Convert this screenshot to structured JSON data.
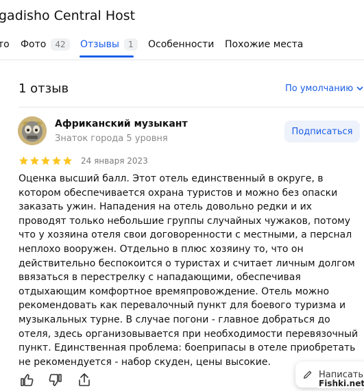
{
  "header": {
    "title": "gadisho Central Host"
  },
  "tabs": [
    {
      "label": "то",
      "count": ""
    },
    {
      "label": "Фото",
      "count": "42"
    },
    {
      "label": "Отзывы",
      "count": "1",
      "active": true
    },
    {
      "label": "Особенности",
      "count": ""
    },
    {
      "label": "Похожие места",
      "count": ""
    }
  ],
  "reviews_summary": {
    "count_label": "1 отзыв",
    "sort_label": "По умолчанию"
  },
  "review": {
    "author": "Африканский музыкант",
    "level": "Знаток города 5 уровня",
    "subscribe_label": "Подписаться",
    "rating": 5,
    "date": "24 января 2023",
    "text": "Оценка высший балл. Этот отель единственный в округе, в котором обеспечивается охрана туристов и можно без опаски заказать ужин. Нападения на отель довольно редки и их проводят только небольшие группы случайных чужаков, потому что у хозяина отеля свои договоренности с местными, а перснал неплохо вооружен. Отдельно в плюс хозяину то, что он действительно беспокоится о туристах и считает личным долгом ввязаться в перестрелку с нападающими, обеспечивая отдыхающим комфортное времяпровождение. Отель можно рекомендовать как перевалочный пункт для боевого туризма и музыкальных турне. В случае погони - главное добраться до отеля, здесь организовывается при необходимости перевязочный пункт. Единственная проблема: боеприпасы в отеле приобретать не рекомендуется - набор скуден, цены высокие."
  },
  "actions": {
    "write_label": "Написать"
  },
  "watermark": "Fishki.net",
  "colors": {
    "accent": "#1a5ee8",
    "star": "#fcc521",
    "muted": "#8a8a8a"
  },
  "icons": [
    "like-icon",
    "dislike-icon",
    "share-icon",
    "pencil-icon"
  ]
}
